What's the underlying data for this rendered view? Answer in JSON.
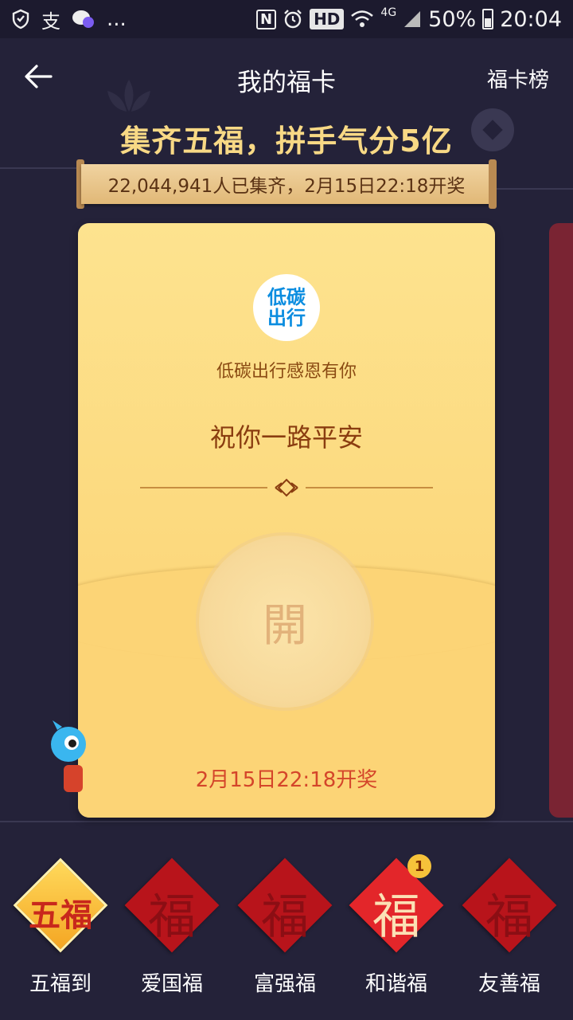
{
  "status_bar": {
    "left_icons": [
      "shield-icon",
      "alipay-icon",
      "wechat-icon",
      "more-dots-icon"
    ],
    "more_text": "...",
    "nfc": "N",
    "hd": "HD",
    "network": "4G",
    "battery_text": "50%",
    "time": "20:04"
  },
  "header": {
    "title": "我的福卡",
    "ranking_label": "福卡榜"
  },
  "headline": "集齐五福，拼手气分5亿",
  "banner_text": "22,044,941人已集齐，2月15日22:18开奖",
  "card": {
    "sponsor_logo_text": "低碳出行",
    "sponsor_name": "低碳出行感恩有你",
    "blessing": "祝你一路平安",
    "open_label": "開",
    "draw_time": "2月15日22:18开奖"
  },
  "fu_tiles": [
    {
      "label": "五福到",
      "char": "五福",
      "style": "gold",
      "count": null
    },
    {
      "label": "爱国福",
      "char": "福",
      "style": "dark",
      "count": null
    },
    {
      "label": "富强福",
      "char": "福",
      "style": "dark",
      "count": null
    },
    {
      "label": "和谐福",
      "char": "福",
      "style": "bright",
      "count": "1"
    },
    {
      "label": "友善福",
      "char": "福",
      "style": "dark",
      "count": null
    }
  ],
  "colors": {
    "background": "#242239",
    "headline_gold": "#f8d985",
    "card_gold": "#fcd679",
    "fu_red": "#b8141b",
    "draw_time_red": "#d4452a"
  }
}
